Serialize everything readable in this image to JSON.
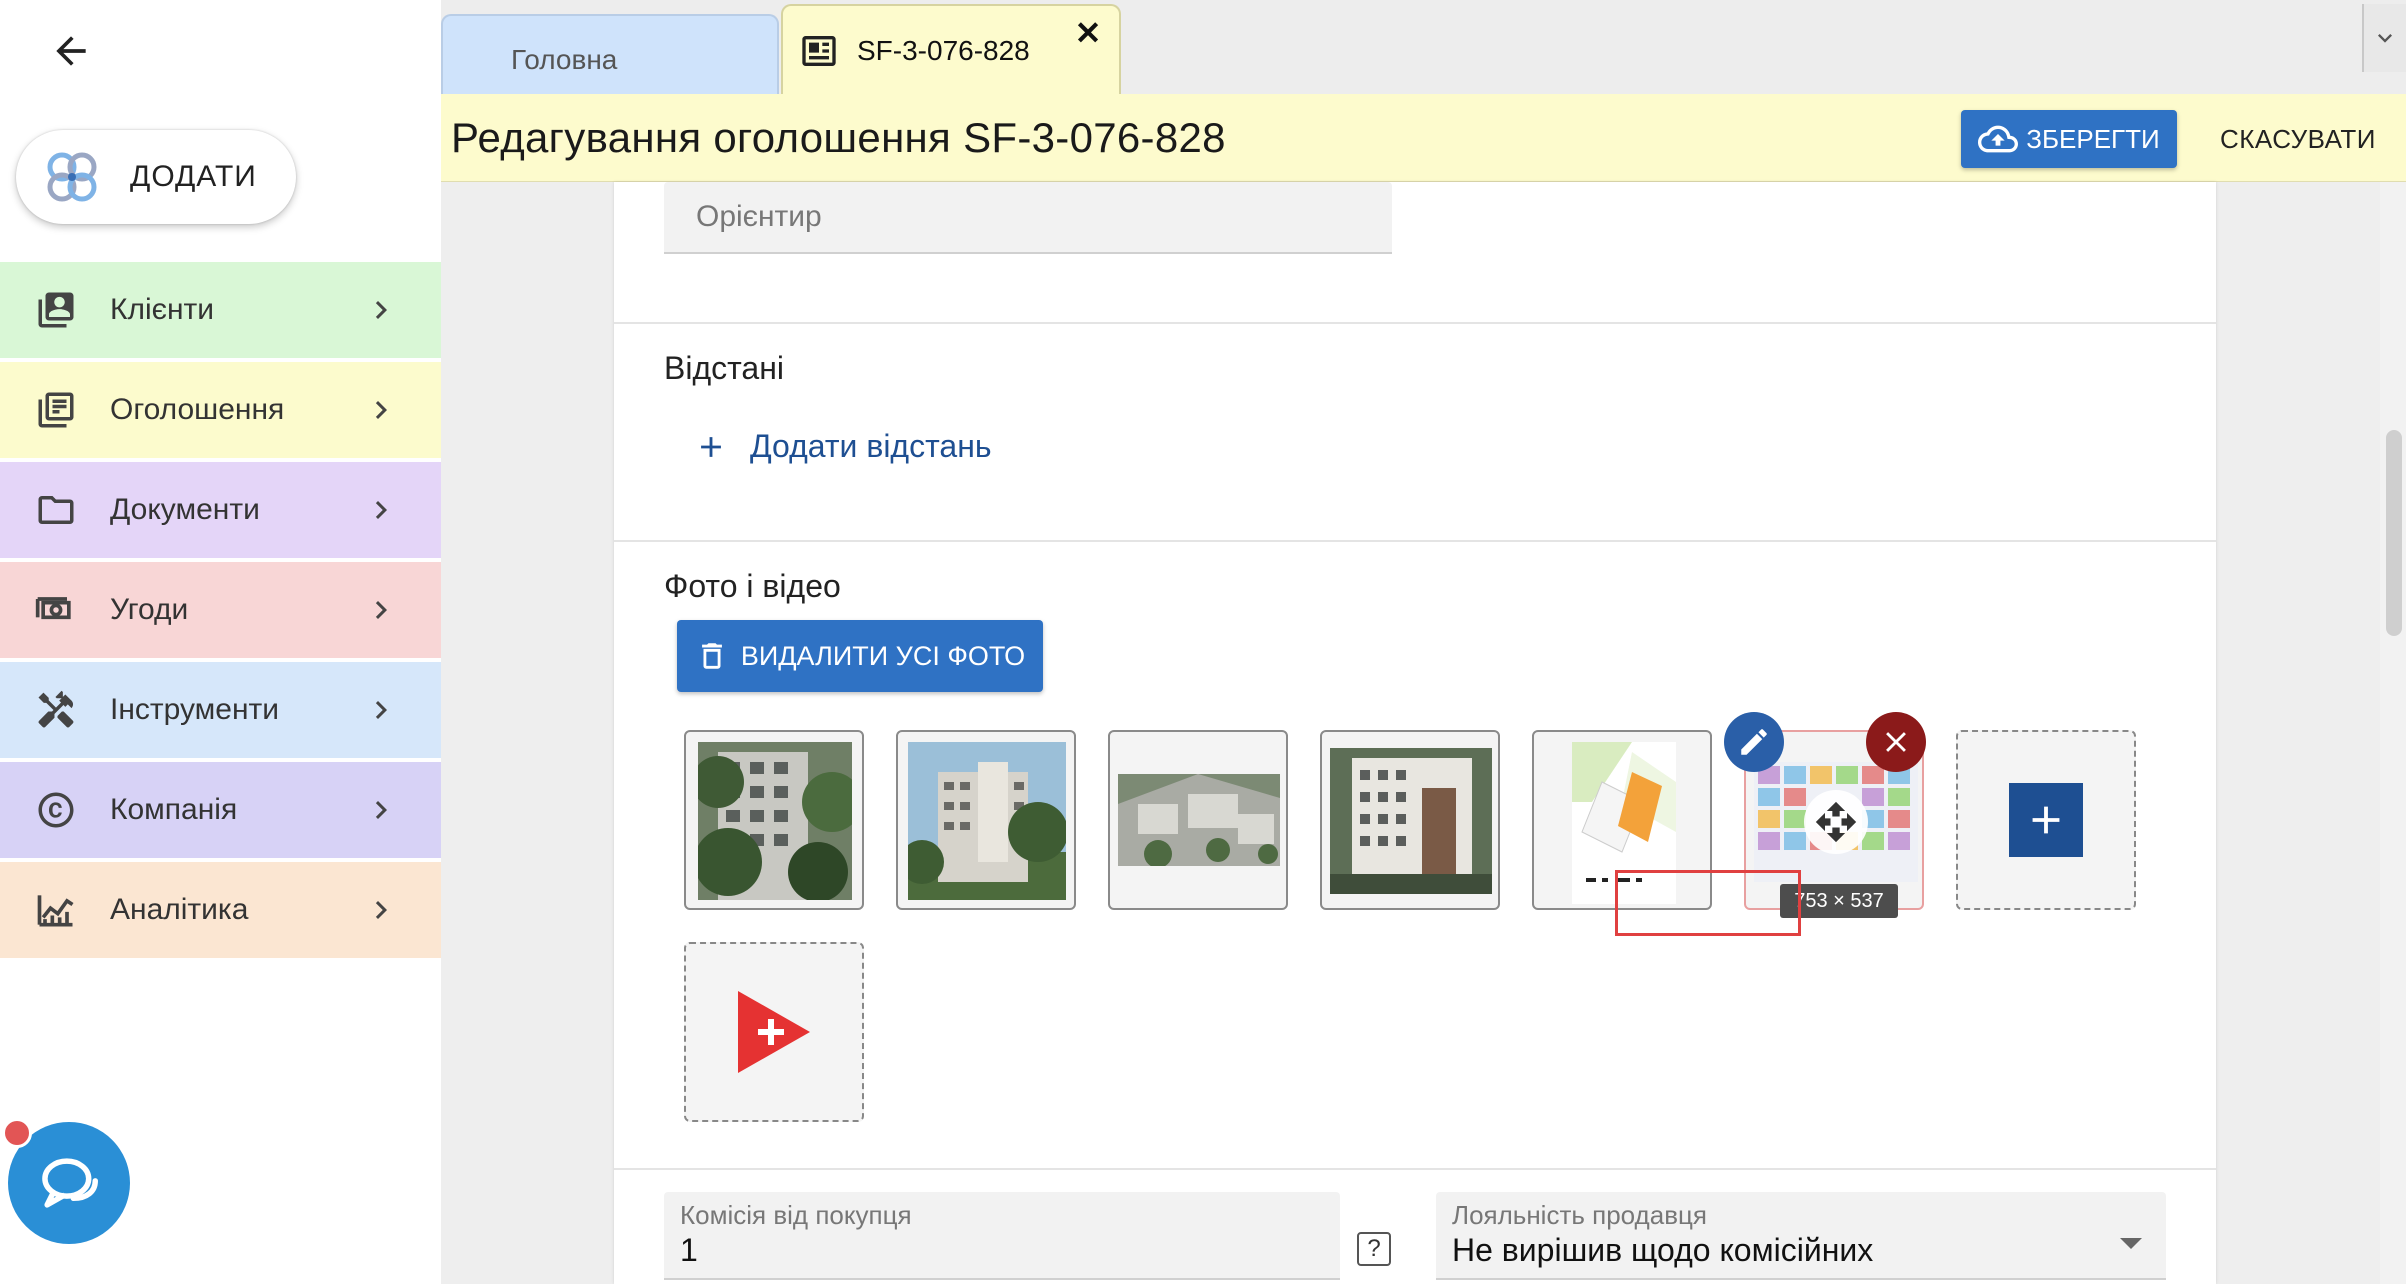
{
  "sidebar": {
    "add_label": "ДОДАТИ",
    "items": [
      {
        "label": "Клієнти",
        "icon": "contacts-icon",
        "bg": "#d9f7d6"
      },
      {
        "label": "Оголошення",
        "icon": "listing-icon",
        "bg": "#fcfbcd"
      },
      {
        "label": "Документи",
        "icon": "folder-icon",
        "bg": "#e4d5f8"
      },
      {
        "label": "Угоди",
        "icon": "money-icon",
        "bg": "#f8d6d6"
      },
      {
        "label": "Інструменти",
        "icon": "tools-icon",
        "bg": "#d6e7fa"
      },
      {
        "label": "Компанія",
        "icon": "copyright-icon",
        "bg": "#d7d2f6"
      },
      {
        "label": "Аналітика",
        "icon": "analytics-icon",
        "bg": "#fbe6d2"
      }
    ]
  },
  "tabs": {
    "home_label": "Головна",
    "active_label": "SF-3-076-828",
    "close_symbol": "✕"
  },
  "header": {
    "title": "Редагування оголошення SF-3-076-828",
    "save_label": "ЗБЕРЕГТИ",
    "cancel_label": "СКАСУВАТИ"
  },
  "form": {
    "landmark_placeholder": "Орієнтир",
    "distances_title": "Відстані",
    "add_distance_label": "Додати відстань",
    "media_title": "Фото і відео",
    "delete_all_label": "ВИДАЛИТИ УСІ ФОТО",
    "hover_dimensions": "753 × 537",
    "commission_label": "Комісія від покупця",
    "commission_value": "1",
    "help_symbol": "?",
    "loyalty_label": "Лояльність продавця",
    "loyalty_value": "Не вирішив щодо комісійних"
  },
  "colors": {
    "primary": "#2f72c4",
    "tab_active": "#fdfbcd",
    "tab_home": "#cfe3fb",
    "remove": "#8b1a1a",
    "video_red": "#e53232"
  }
}
